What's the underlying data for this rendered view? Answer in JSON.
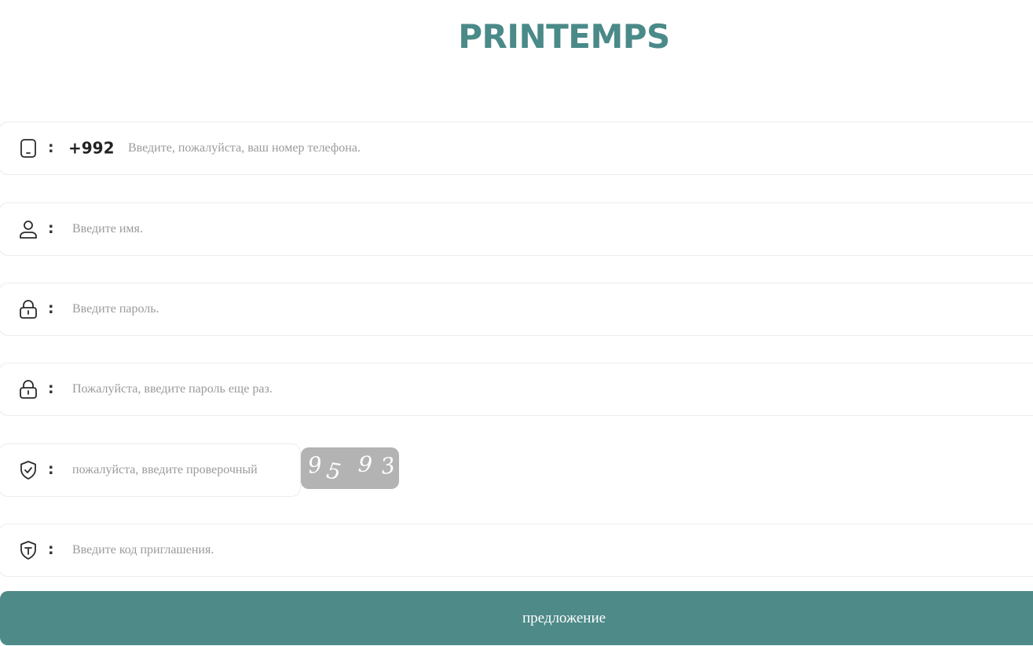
{
  "brand": {
    "name": "PRINTEMPS"
  },
  "form": {
    "phone": {
      "icon": "phone-icon",
      "colon": ":",
      "prefix": "+992",
      "placeholder": "Введите, пожалуйста, ваш номер телефона.",
      "value": ""
    },
    "name": {
      "icon": "user-icon",
      "colon": ":",
      "placeholder": "Введите имя.",
      "value": ""
    },
    "password": {
      "icon": "lock-icon",
      "colon": ":",
      "placeholder": "Введите пароль.",
      "value": ""
    },
    "password_repeat": {
      "icon": "lock-icon",
      "colon": ":",
      "placeholder": "Пожалуйста, введите пароль еще раз.",
      "value": ""
    },
    "verification": {
      "icon": "shield-check-icon",
      "colon": ":",
      "placeholder": "пожалуйста, введите проверочный",
      "value": ""
    },
    "captcha": {
      "digits": [
        "9",
        "5",
        "9",
        "3"
      ]
    },
    "invite": {
      "icon": "shield-t-icon",
      "colon": ":",
      "placeholder": "Введите код приглашения.",
      "value": ""
    },
    "submit_label": "предложение"
  },
  "colors": {
    "brand": "#4a8a88",
    "button": "#4d8a88",
    "captcha_bg": "#b3b3b3",
    "placeholder": "#9a9a9a"
  }
}
